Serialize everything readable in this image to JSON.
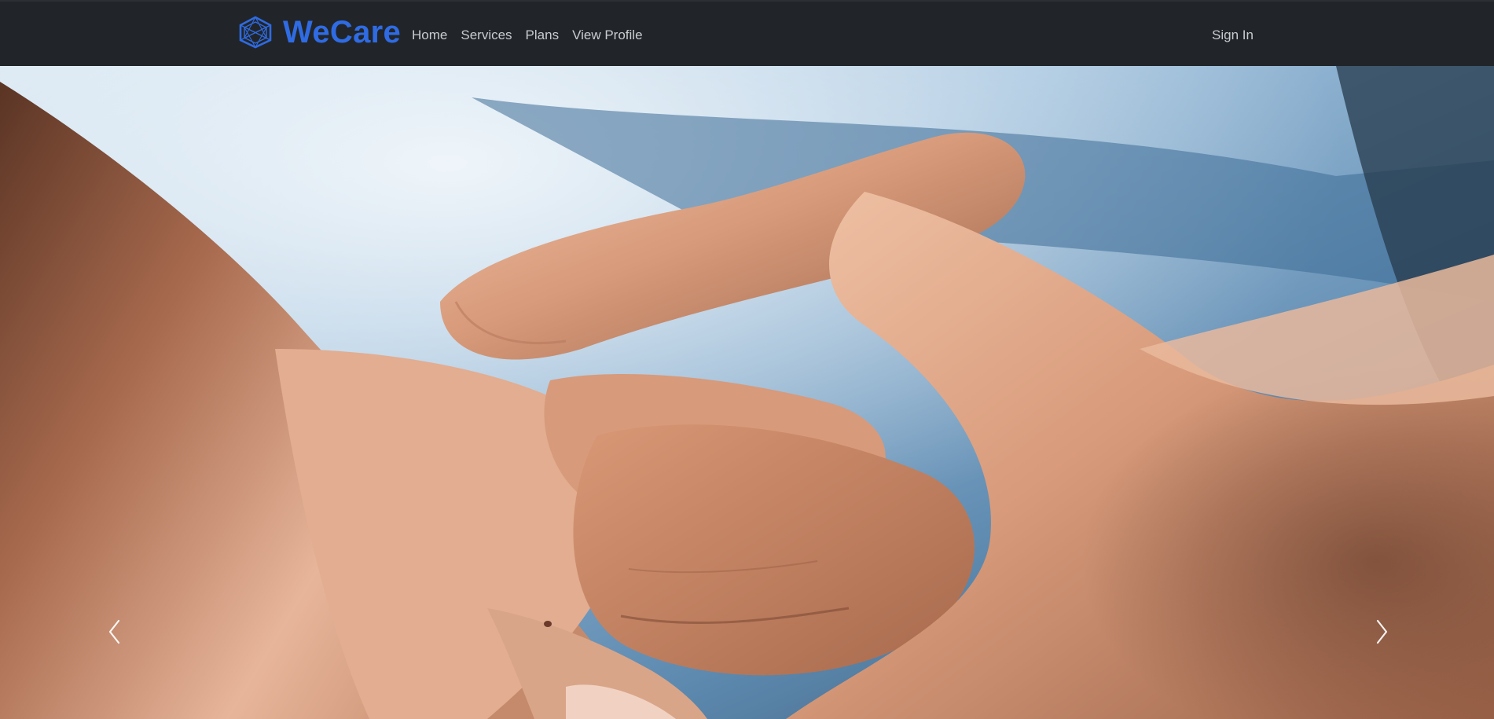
{
  "brand": {
    "name": "WeCare",
    "logo_icon": "hexagon-network-icon",
    "color": "#2f6be3"
  },
  "nav": {
    "items": [
      {
        "label": "Home"
      },
      {
        "label": "Services"
      },
      {
        "label": "Plans"
      },
      {
        "label": "View Profile"
      }
    ],
    "sign_in_label": "Sign In"
  },
  "carousel": {
    "image": "clasped-hands-photo",
    "prev_icon": "chevron-left-icon",
    "next_icon": "chevron-right-icon"
  },
  "colors": {
    "navbar_bg": "#212529",
    "nav_text": "#c9cccf"
  }
}
